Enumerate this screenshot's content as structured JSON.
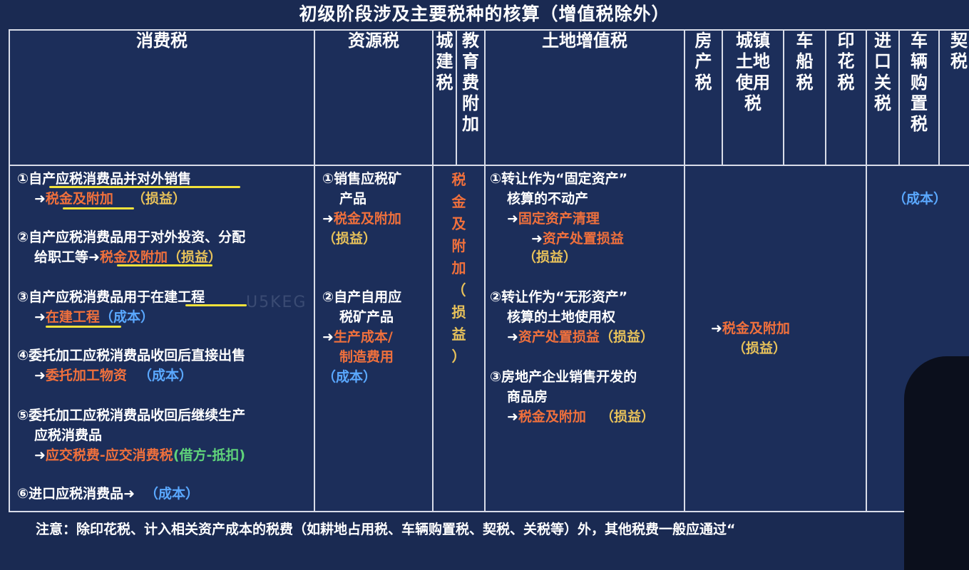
{
  "title": "初级阶段涉及主要税种的核算（增值税除外）",
  "headers": {
    "consumption": "消费税",
    "resource": "资源税",
    "city": [
      "城",
      "建",
      "税"
    ],
    "edu": [
      "教",
      "育",
      "费",
      "附",
      "加"
    ],
    "land_vat": "土地增值税",
    "property": [
      "房",
      "产",
      "税"
    ],
    "urban_land": [
      "城镇",
      "土地",
      "使用",
      "税"
    ],
    "vehicle_vessel": [
      "车",
      "船",
      "税"
    ],
    "stamp": [
      "印",
      "花",
      "税"
    ],
    "import_duty": [
      "进",
      "口",
      "关",
      "税"
    ],
    "vehicle_purchase": [
      "车",
      "辆",
      "购",
      "置",
      "税"
    ],
    "deed": [
      "契",
      "税"
    ]
  },
  "consumption": {
    "i1": "①自产应税消费品并对外销售",
    "i1_acct": "税金及附加",
    "i1_tag": "（损益）",
    "i2a": "②自产应税消费品用于对外投资、分配",
    "i2b": "给职工等",
    "i2_acct": "税金及附加",
    "i2_tag": "（损益）",
    "i3": "③自产应税消费品用于在建工程",
    "i3_acct": "在建工程",
    "i3_tag": "（成本）",
    "i4": "④委托加工应税消费品收回后直接出售",
    "i4_acct": "委托加工物资",
    "i4_tag": "（成本）",
    "i5a": "⑤委托加工应税消费品收回后继续生产",
    "i5b": "应税消费品",
    "i5_acct": "应交税费-应交消费税",
    "i5_tag": "(借方-抵扣)",
    "i6": "⑥进口应税消费品",
    "i6_tag": "（成本）"
  },
  "resource": {
    "i1a": "①销售应税矿",
    "i1b": "产品",
    "i1_acct": "税金及附加",
    "i1_tag": "（损益）",
    "i2a": "②自产自用应",
    "i2b": "税矿产品",
    "i2_acct_a": "生产成本/",
    "i2_acct_b": "制造费用",
    "i2_tag": "（成本）"
  },
  "city_edu": {
    "chars": [
      "税",
      "金",
      "及",
      "附",
      "加"
    ],
    "tag": [
      "（",
      "损",
      "益",
      "）"
    ]
  },
  "land_vat": {
    "i1a": "①转让作为“固定资产”",
    "i1b": "核算的不动产",
    "i1_acct1": "固定资产清理",
    "i1_acct2": "资产处置损益",
    "i1_tag": "（损益）",
    "i2a": "②转让作为“无形资产”",
    "i2b": "核算的土地使用权",
    "i2_acct": "资产处置损益",
    "i2_tag": "（损益）",
    "i3a": "③房地产企业销售开发的",
    "i3b": "商品房",
    "i3_acct": "税金及附加",
    "i3_tag": "（损益）"
  },
  "group_mid": {
    "acct": "税金及附加",
    "tag": "（损益）"
  },
  "group_right": {
    "tag": "（成本）"
  },
  "arrow": "➜",
  "watermark": "U5KEG",
  "note": "注意：除印花税、计入相关资产成本的税费（如耕地占用税、车辆购置税、契税、关税等）外，其他税费一般应通过“"
}
